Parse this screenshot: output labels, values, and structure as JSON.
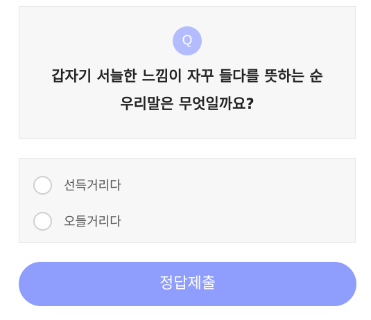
{
  "question": {
    "badge": "Q",
    "line1": "갑자기 서늘한 느낌이 자꾸 들다를 뜻하는 순",
    "line2": "우리말은 무엇일까요?"
  },
  "options": [
    {
      "label": "선득거리다",
      "selected": false
    },
    {
      "label": "오들거리다",
      "selected": false
    }
  ],
  "submit": {
    "label": "정답제출"
  },
  "colors": {
    "accent": "#8f9dfd",
    "badge": "#b3bcff",
    "card_background": "#f7f7f7"
  }
}
